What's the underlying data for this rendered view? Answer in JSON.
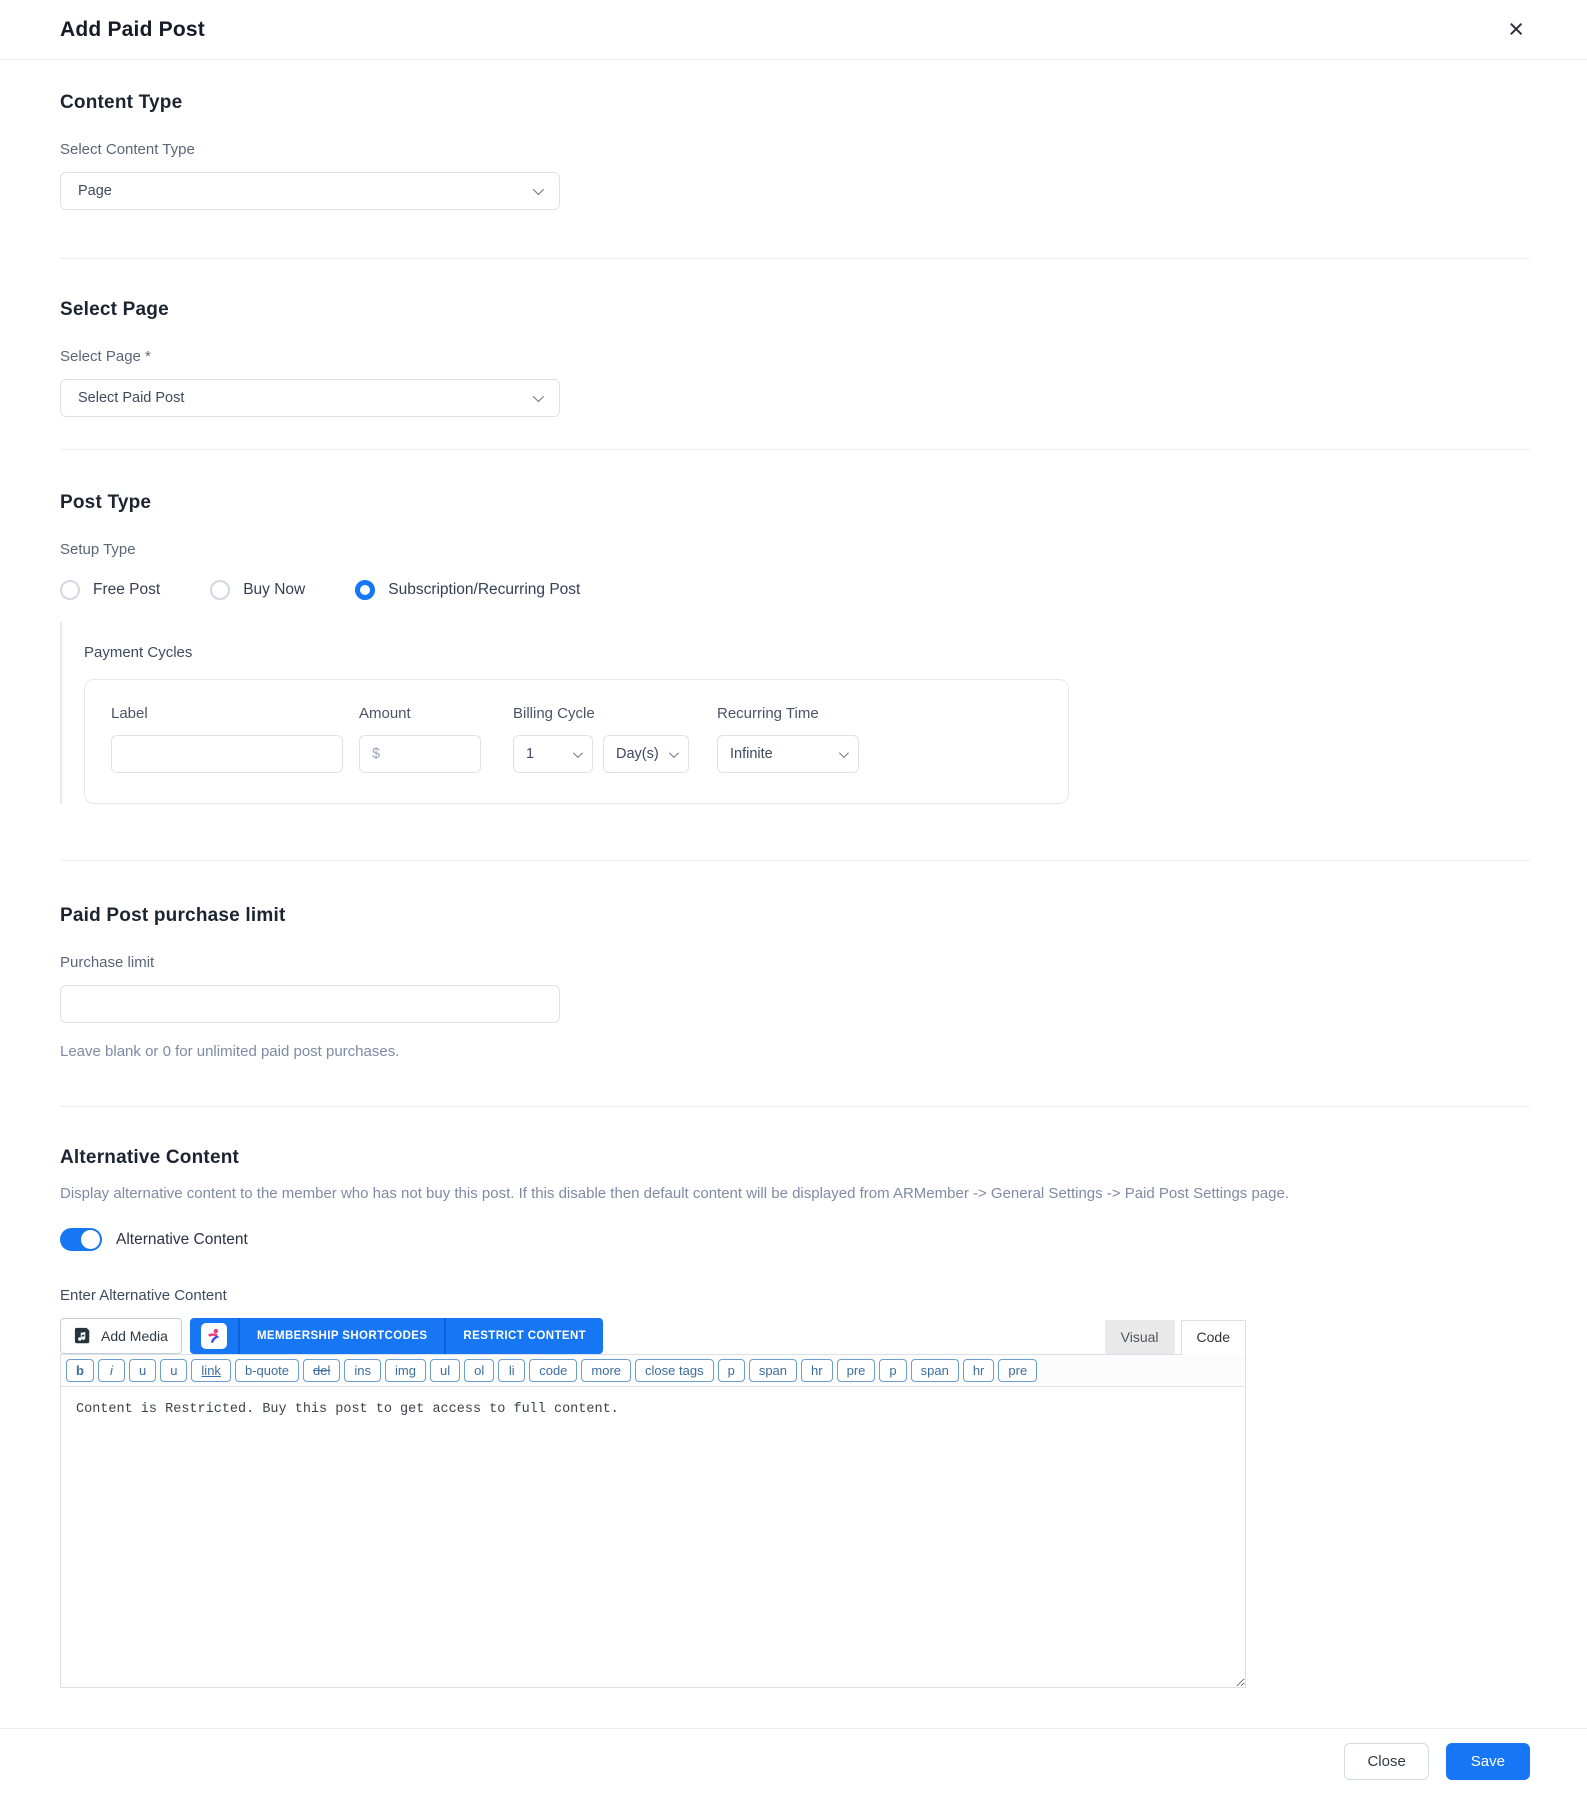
{
  "modal": {
    "title": "Add Paid Post"
  },
  "content_type": {
    "heading": "Content Type",
    "label": "Select Content Type",
    "value": "Page"
  },
  "select_page": {
    "heading": "Select Page",
    "label": "Select Page *",
    "value": "Select Paid Post"
  },
  "post_type": {
    "heading": "Post Type",
    "label": "Setup Type",
    "options": [
      {
        "label": "Free Post",
        "selected": false
      },
      {
        "label": "Buy Now",
        "selected": false
      },
      {
        "label": "Subscription/Recurring Post",
        "selected": true
      }
    ]
  },
  "payment_cycles": {
    "heading": "Payment Cycles",
    "columns": [
      "Label",
      "Amount",
      "Billing Cycle",
      "Recurring Time"
    ],
    "row": {
      "label_value": "",
      "amount_placeholder": "$",
      "billing_cycle_count": "1",
      "billing_cycle_unit": "Day(s)",
      "recurring_time": "Infinite"
    }
  },
  "purchase_limit": {
    "heading": "Paid Post purchase limit",
    "label": "Purchase limit",
    "value": "",
    "hint": "Leave blank or 0 for unlimited paid post purchases."
  },
  "alternative_content": {
    "heading": "Alternative Content",
    "description": "Display alternative content to the member who has not buy this post. If this disable then default content will be displayed from ARMember -> General Settings -> Paid Post Settings page.",
    "toggle_label": "Alternative Content",
    "toggle_on": true,
    "editor_label": "Enter Alternative Content"
  },
  "editor": {
    "add_media_label": "Add Media",
    "shortcode_buttons": [
      "MEMBERSHIP SHORTCODES",
      "RESTRICT CONTENT"
    ],
    "tabs": [
      {
        "label": "Visual",
        "active": false
      },
      {
        "label": "Code",
        "active": true
      }
    ],
    "quicktags": [
      "b",
      "i",
      "u",
      "u",
      "link",
      "b-quote",
      "del",
      "ins",
      "img",
      "ul",
      "ol",
      "li",
      "code",
      "more",
      "close tags",
      "p",
      "span",
      "hr",
      "pre",
      "p",
      "span",
      "hr",
      "pre"
    ],
    "content": "Content is Restricted. Buy this post to get access to full content."
  },
  "footer": {
    "close_label": "Close",
    "save_label": "Save"
  },
  "colors": {
    "accent": "#1676f3",
    "heading_text": "#1b2430",
    "label_text": "#5a6678",
    "hint_text": "#7f8aa3",
    "quicktag_blue": "#3c6d9f"
  }
}
